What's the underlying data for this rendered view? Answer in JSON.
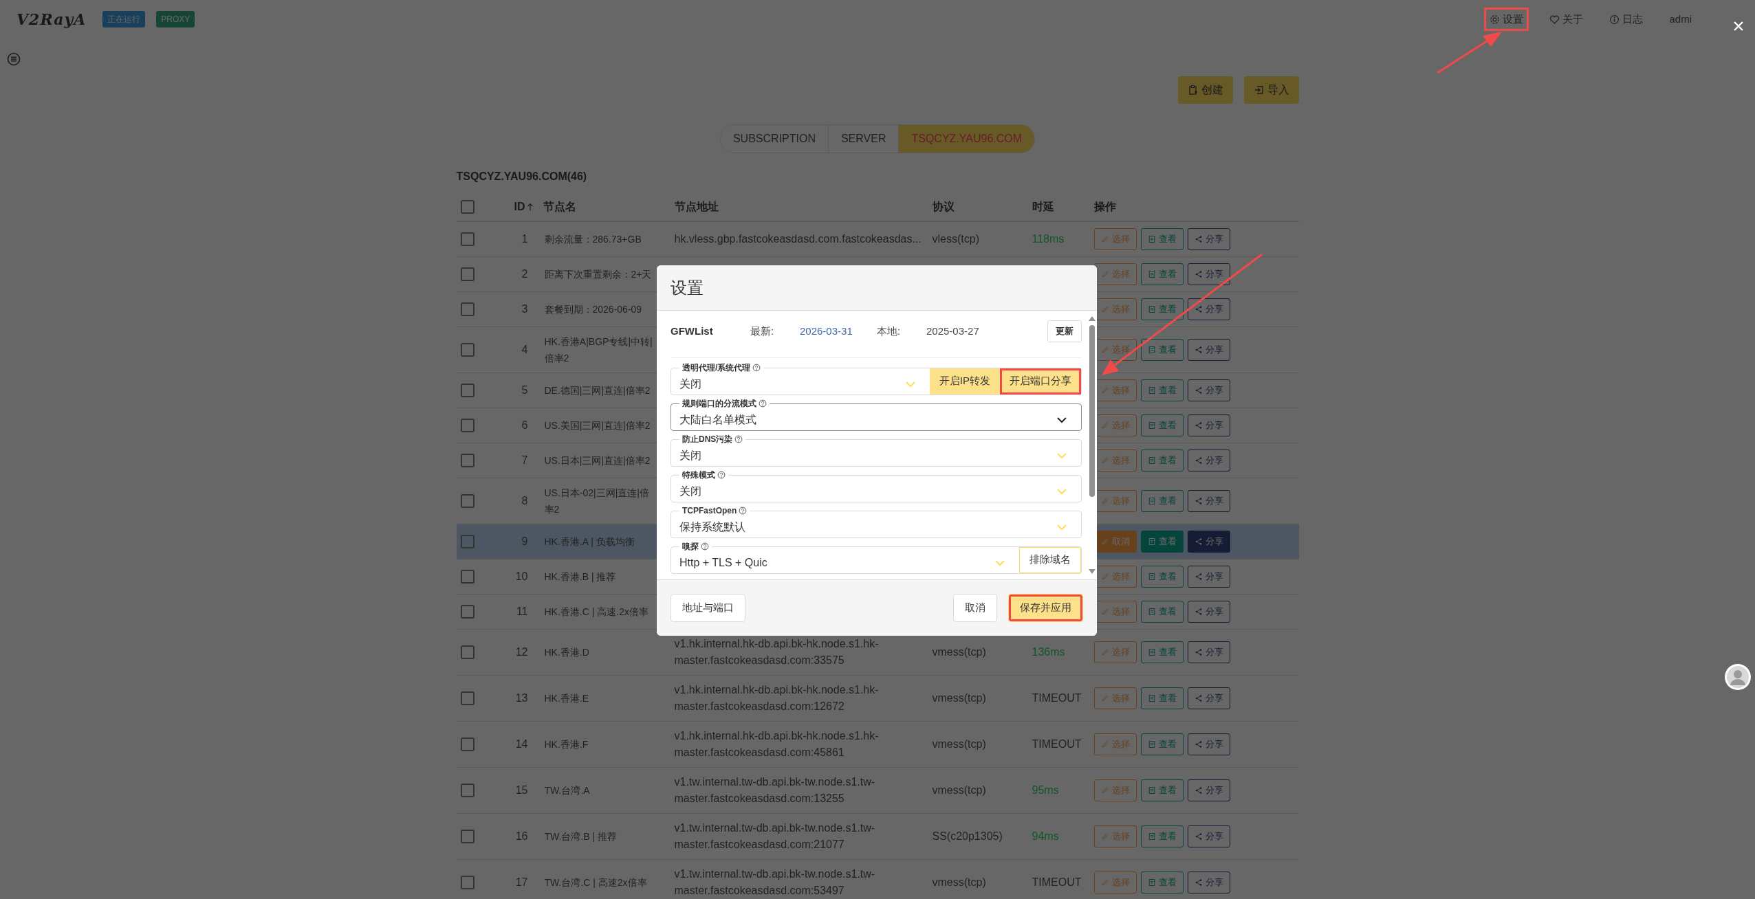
{
  "navbar": {
    "logo": "V2RayA",
    "badges": [
      {
        "text": "正在运行",
        "kind": "running"
      },
      {
        "text": "PROXY",
        "kind": "mode"
      }
    ],
    "items": [
      {
        "label": "设置",
        "highlighted": true
      },
      {
        "label": "关于",
        "highlighted": false
      },
      {
        "label": "日志",
        "highlighted": false
      }
    ],
    "user": "admi"
  },
  "toolbar": [
    {
      "label": "创建"
    },
    {
      "label": "导入"
    }
  ],
  "tabs": [
    {
      "label": "SUBSCRIPTION",
      "selected": false
    },
    {
      "label": "SERVER",
      "selected": false
    },
    {
      "label": "TSQCYZ.YAU96.COM",
      "selected": true
    }
  ],
  "table": {
    "title": "TSQCYZ.YAU96.COM(46)",
    "select_all_checked": false,
    "columns": [
      "ID",
      "节点名",
      "节点地址",
      "协议",
      "时延",
      "操作"
    ],
    "rows": [
      {
        "id": "1",
        "name": "剩余流量：286.73+GB",
        "address": "hk.vless.gbp.fastcokeasdasd.com.fastcokeasdas...",
        "protocol": "vless(tcp)",
        "latency": {
          "text": "118ms",
          "kind": "ok"
        },
        "checked": false,
        "selected": false,
        "actions": [
          "选择",
          "查看",
          "分享"
        ]
      },
      {
        "id": "2",
        "name": "距离下次重置剩余：2+天",
        "checked": false,
        "selected": false,
        "actions": [
          "选择",
          "查看",
          "分享"
        ]
      },
      {
        "id": "3",
        "name": "套餐到期：2026-06-09",
        "checked": false,
        "selected": false,
        "actions": [
          "选择",
          "查看",
          "分享"
        ]
      },
      {
        "id": "4",
        "name": "HK.香港A|BGP专线|中转|倍率2",
        "checked": false,
        "selected": false,
        "actions": [
          "选择",
          "查看",
          "分享"
        ]
      },
      {
        "id": "5",
        "name": "DE.德国|三网|直连|倍率2",
        "checked": false,
        "selected": false,
        "actions": [
          "选择",
          "查看",
          "分享"
        ]
      },
      {
        "id": "6",
        "name": "US.美国|三网|直连|倍率2",
        "checked": false,
        "selected": false,
        "actions": [
          "选择",
          "查看",
          "分享"
        ]
      },
      {
        "id": "7",
        "name": "US.日本|三网|直连|倍率2",
        "checked": false,
        "selected": false,
        "actions": [
          "选择",
          "查看",
          "分享"
        ]
      },
      {
        "id": "8",
        "name": "US.日本-02|三网|直连|倍率2",
        "checked": false,
        "selected": false,
        "actions": [
          "选择",
          "查看",
          "分享"
        ]
      },
      {
        "id": "9",
        "name": "HK.香港.A | 负载均衡",
        "checked": false,
        "selected": true,
        "actions": [
          "取消",
          "查看",
          "分享"
        ]
      },
      {
        "id": "10",
        "name": "HK.香港.B | 推荐",
        "checked": false,
        "selected": false,
        "actions": [
          "选择",
          "查看",
          "分享"
        ]
      },
      {
        "id": "11",
        "name": "HK.香港.C | 高速.2x倍率",
        "checked": false,
        "selected": false,
        "actions": [
          "选择",
          "查看",
          "分享"
        ]
      },
      {
        "id": "12",
        "name": "HK.香港.D",
        "address": "v1.hk.internal.hk-db.api.bk-hk.node.s1.hk-master.fastcokeasdasd.com:33575",
        "protocol": "vmess(tcp)",
        "latency": {
          "text": "136ms",
          "kind": "ok"
        },
        "checked": false,
        "selected": false,
        "actions": [
          "选择",
          "查看",
          "分享"
        ]
      },
      {
        "id": "13",
        "name": "HK.香港.E",
        "address": "v1.hk.internal.hk-db.api.bk-hk.node.s1.hk-master.fastcokeasdasd.com:12672",
        "protocol": "vmess(tcp)",
        "latency": {
          "text": "TIMEOUT",
          "kind": "timeout"
        },
        "checked": false,
        "selected": false,
        "actions": [
          "选择",
          "查看",
          "分享"
        ]
      },
      {
        "id": "14",
        "name": "HK.香港.F",
        "address": "v1.hk.internal.hk-db.api.bk-hk.node.s1.hk-master.fastcokeasdasd.com:45861",
        "protocol": "vmess(tcp)",
        "latency": {
          "text": "TIMEOUT",
          "kind": "timeout"
        },
        "checked": false,
        "selected": false,
        "actions": [
          "选择",
          "查看",
          "分享"
        ]
      },
      {
        "id": "15",
        "name": "TW.台湾.A",
        "address": "v1.tw.internal.tw-db.api.bk-tw.node.s1.tw-master.fastcokeasdasd.com:13255",
        "protocol": "vmess(tcp)",
        "latency": {
          "text": "95ms",
          "kind": "ok"
        },
        "checked": false,
        "selected": false,
        "actions": [
          "选择",
          "查看",
          "分享"
        ]
      },
      {
        "id": "16",
        "name": "TW.台湾.B | 推荐",
        "address": "v1.tw.internal.tw-db.api.bk-tw.node.s1.tw-master.fastcokeasdasd.com:21077",
        "protocol": "SS(c20p1305)",
        "latency": {
          "text": "94ms",
          "kind": "ok"
        },
        "checked": false,
        "selected": false,
        "actions": [
          "选择",
          "查看",
          "分享"
        ]
      },
      {
        "id": "17",
        "name": "TW.台湾.C | 高速2x倍率",
        "address": "v1.tw.internal.tw-db.api.bk-tw.node.s1.tw-master.fastcokeasdasd.com:53497",
        "protocol": "vmess(tcp)",
        "latency": {
          "text": "TIMEOUT",
          "kind": "timeout"
        },
        "checked": false,
        "selected": false,
        "actions": [
          "选择",
          "查看",
          "分享"
        ]
      }
    ]
  },
  "modal": {
    "title": "设置",
    "gfwlist": {
      "name": "GFWList",
      "latest_label": "最新:",
      "latest": "2026-03-31",
      "local_label": "本地:",
      "local": "2025-03-27",
      "button": "更新"
    },
    "fields": [
      {
        "label": "透明代理/系统代理",
        "value": "关闭",
        "kind": "select",
        "addons": [
          {
            "label": "开启IP转发",
            "kind": "filled",
            "highlighted": false
          },
          {
            "label": "开启端口分享",
            "kind": "filled",
            "highlighted": true
          }
        ]
      },
      {
        "label": "规则端口的分流模式",
        "value": "大陆白名单模式",
        "kind": "native"
      },
      {
        "label": "防止DNS污染",
        "value": "关闭",
        "kind": "select"
      },
      {
        "label": "特殊模式",
        "value": "关闭",
        "kind": "select"
      },
      {
        "label": "TCPFastOpen",
        "value": "保持系统默认",
        "kind": "select"
      },
      {
        "label": "嗅探",
        "value": "Http + TLS + Quic",
        "kind": "select",
        "addons": [
          {
            "label": "排除域名",
            "kind": "outline",
            "highlighted": false
          }
        ]
      }
    ],
    "footer": {
      "left": "地址与端口",
      "buttons": [
        {
          "label": "取消",
          "kind": "default",
          "highlighted": false
        },
        {
          "label": "保存并应用",
          "kind": "primary",
          "highlighted": true
        }
      ]
    }
  }
}
